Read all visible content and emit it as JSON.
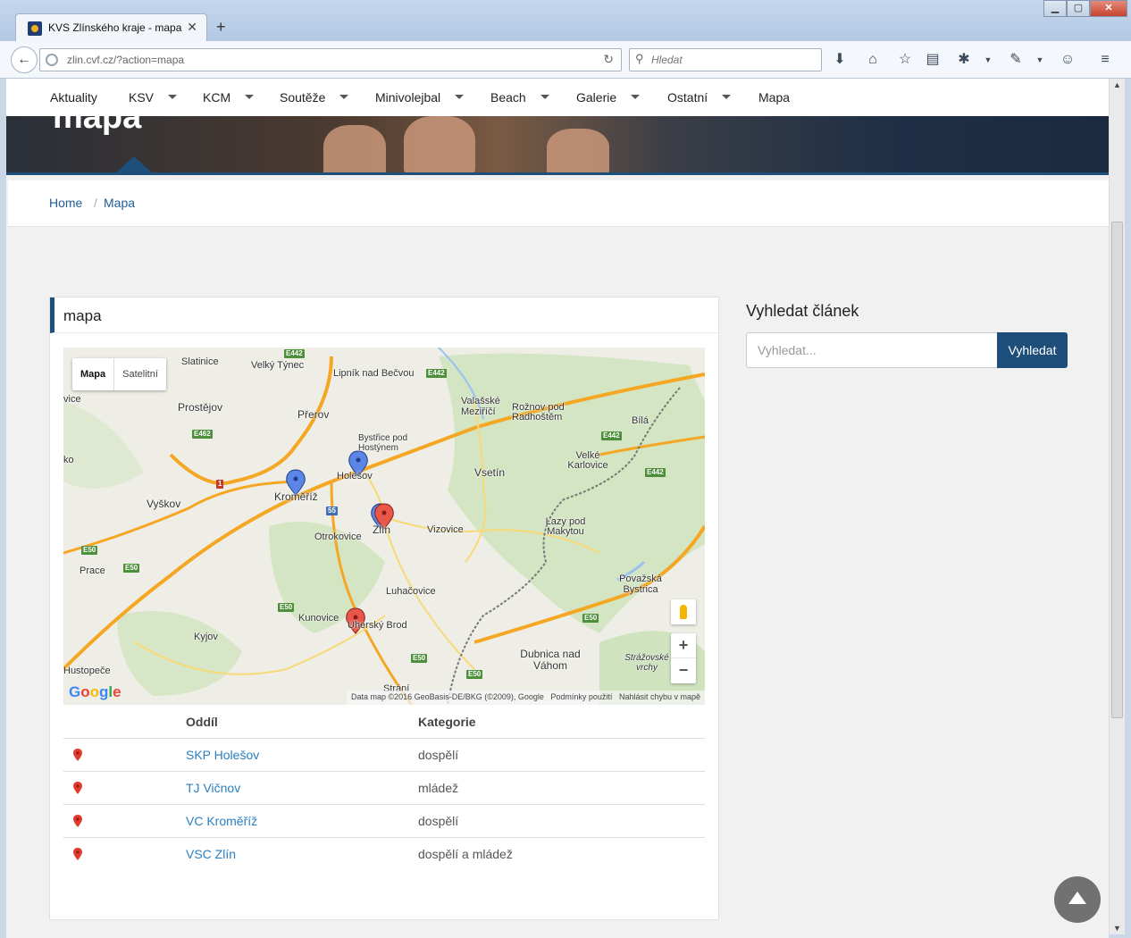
{
  "browser": {
    "tab_title": "KVS Zlínského kraje - mapa",
    "tab_close": "✕",
    "new_tab": "+",
    "url": "zlin.cvf.cz/?action=mapa",
    "search_placeholder": "Hledat",
    "window_min": "▁",
    "window_max": "▢",
    "window_close": "✕",
    "icons": [
      "download-icon",
      "home-icon",
      "bookmark-star-icon",
      "reading-list-icon",
      "extension-icon",
      "dropper-icon",
      "smiley-icon",
      "menu-icon"
    ]
  },
  "site": {
    "menu": [
      {
        "label": "Aktuality",
        "dropdown": false
      },
      {
        "label": "KSV",
        "dropdown": true
      },
      {
        "label": "KCM",
        "dropdown": true
      },
      {
        "label": "Soutěže",
        "dropdown": true
      },
      {
        "label": "Minivolejbal",
        "dropdown": true
      },
      {
        "label": "Beach",
        "dropdown": true
      },
      {
        "label": "Galerie",
        "dropdown": true
      },
      {
        "label": "Ostatní",
        "dropdown": true
      },
      {
        "label": "Mapa",
        "dropdown": false
      }
    ],
    "hero_title": "mapa",
    "breadcrumb": {
      "home": "Home",
      "separator": "/",
      "current": "Mapa"
    }
  },
  "panel": {
    "title": "mapa",
    "map": {
      "type_buttons": {
        "map": "Mapa",
        "satellite": "Satelitní"
      },
      "zoom_in": "+",
      "zoom_out": "−",
      "attribution": "Data map ©2016 GeoBasis-DE/BKG (©2009), Google",
      "terms": "Podmínky použití",
      "report": "Nahlásit chybu v mapě",
      "logo": "Google",
      "labels": [
        "Slatinice",
        "Velký Týnec",
        "Lipník nad Bečvou",
        "Prostějov",
        "Přerov",
        "Valašské Meziříčí",
        "Rožnov pod Radhoštěm",
        "Bílá",
        "Bystřice pod Hostýnem",
        "Holešov",
        "Kroměříž",
        "Vyškov",
        "Vsetín",
        "Velké Karlovice",
        "Otrokovice",
        "Zlín",
        "Vizovice",
        "Lazy pod Makytou",
        "Prace",
        "Luhačovice",
        "Považská Bystrica",
        "Kunovice",
        "Uherský Brod",
        "Kyjov",
        "Dubnica nad Váhom",
        "Strážovské vrchy",
        "Hustopeče",
        "Strání",
        "vice",
        "ko"
      ],
      "shields": [
        "E442",
        "E442",
        "E462",
        "E442",
        "E442",
        "55",
        "1",
        "E50",
        "E50",
        "E50",
        "E50",
        "E50",
        "E50"
      ]
    },
    "table": {
      "headers": {
        "club": "Oddíl",
        "category": "Kategorie"
      },
      "rows": [
        {
          "club": "SKP Holešov",
          "category": "dospělí"
        },
        {
          "club": "TJ Vičnov",
          "category": "mládež"
        },
        {
          "club": "VC Kroměříž",
          "category": "dospělí"
        },
        {
          "club": "VSC Zlín",
          "category": "dospělí a mládež"
        }
      ]
    }
  },
  "sidebar": {
    "title": "Vyhledat článek",
    "search_placeholder": "Vyhledat...",
    "search_button": "Vyhledat"
  },
  "colors": {
    "brand": "#1d4f7a",
    "link": "#2a7fc1",
    "marker_blue": "#5b86e5",
    "marker_red": "#e8584a"
  }
}
